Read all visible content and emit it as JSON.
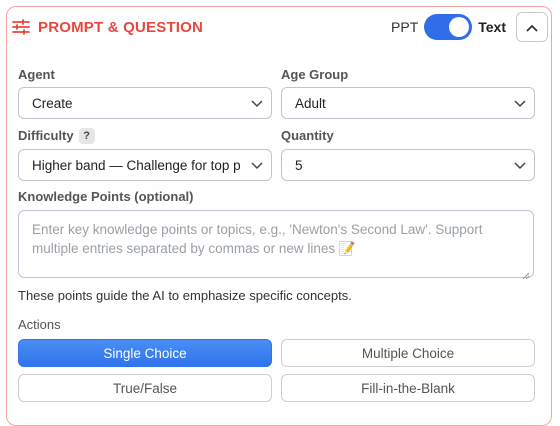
{
  "header": {
    "title": "PROMPT & QUESTION",
    "toggle": {
      "left_label": "PPT",
      "right_label": "Text",
      "state": "Text"
    }
  },
  "fields": {
    "agent": {
      "label": "Agent",
      "value": "Create"
    },
    "age_group": {
      "label": "Age Group",
      "value": "Adult"
    },
    "difficulty": {
      "label": "Difficulty",
      "help": "?",
      "value": "Higher band — Challenge for top p"
    },
    "quantity": {
      "label": "Quantity",
      "value": "5"
    }
  },
  "knowledge": {
    "label": "Knowledge Points (optional)",
    "placeholder": "Enter key knowledge points or topics, e.g., 'Newton's Second Law'. Support multiple entries separated by commas or new lines 📝",
    "hint": "These points guide the AI to emphasize specific concepts."
  },
  "actions": {
    "label": "Actions",
    "options": [
      "Single Choice",
      "Multiple Choice",
      "True/False",
      "Fill-in-the-Blank"
    ],
    "selected": "Single Choice"
  },
  "colors": {
    "accent": "#e8473e",
    "primary": "#2f74ec",
    "border": "#f5a3a3"
  }
}
